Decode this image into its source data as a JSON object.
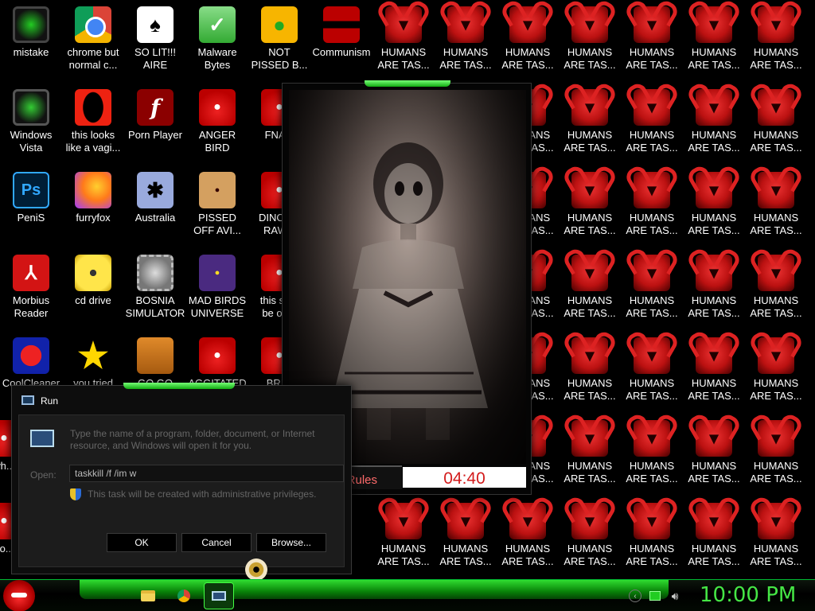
{
  "desktop": {
    "icons": [
      {
        "label": "mistake",
        "icon": "green-sphere-icon"
      },
      {
        "label": "chrome but\nnormal c...",
        "icon": "chrome-icon"
      },
      {
        "label": "SO LIT!!!\nAIRE",
        "icon": "solitaire-card-icon"
      },
      {
        "label": "Malware\nBytes",
        "icon": "shield-check-icon"
      },
      {
        "label": "NOT\nPISSED B...",
        "icon": "green-pig-icon"
      },
      {
        "label": "Communism",
        "icon": "arstotzka-flag-icon"
      },
      {
        "label": "Windows\nVista",
        "icon": "recycle-orb-icon"
      },
      {
        "label": "this looks\nlike a vagi...",
        "icon": "opera-icon"
      },
      {
        "label": "Porn Player",
        "icon": "flash-player-icon"
      },
      {
        "label": "ANGER\nBIRD",
        "icon": "angry-bird-icon"
      },
      {
        "label": "FNA...",
        "icon": "angry-bird-icon"
      },
      {
        "label": "PeniS",
        "icon": "photoshop-icon"
      },
      {
        "label": "furryfox",
        "icon": "firefox-icon"
      },
      {
        "label": "Australia",
        "icon": "spider-solitaire-icon"
      },
      {
        "label": "PISSED\nOFF AVI...",
        "icon": "angry-birds-seasons-icon"
      },
      {
        "label": "DINOS...\nRAW...",
        "icon": "angry-bird-icon"
      },
      {
        "label": "Morbius\nReader",
        "icon": "pdf-reader-icon"
      },
      {
        "label": "cd drive",
        "icon": "cd-drive-icon"
      },
      {
        "label": "BOSNIA\nSIMULATOR",
        "icon": "spiked-mine-icon"
      },
      {
        "label": "MAD BIRDS\nUNIVERSE",
        "icon": "angry-birds-space-icon"
      },
      {
        "label": "this sh...\nbe on...",
        "icon": "angry-bird-icon"
      },
      {
        "label": "CoolCleaner",
        "icon": "ccleaner-icon"
      },
      {
        "label": "you tried",
        "icon": "gold-star-icon"
      },
      {
        "label": "GO GO",
        "icon": "briefcase-icon"
      },
      {
        "label": "AGGITATED",
        "icon": "angry-bird-icon"
      },
      {
        "label": "BRI...",
        "icon": "angry-bird-icon"
      },
      {
        "label": "wh...",
        "icon": "angry-bird-icon"
      },
      {
        "label": "do...",
        "icon": "angry-bird-icon"
      }
    ],
    "demon_label": "HUMANS\nARE TAS...",
    "demon_icon": "red-demon-icon"
  },
  "horror_window": {
    "show_rules": "Show Rules",
    "timer": "04:40",
    "image_subject": "ghost-girl-photo"
  },
  "run_dialog": {
    "title": "Run",
    "description": "Type the name of a program, folder, document, or Internet\nresource, and Windows will open it for you.",
    "open_label": "Open:",
    "input_value": "taskkill /f /im w",
    "admin_note": "This task will be created with administrative privileges.",
    "ok": "OK",
    "cancel": "Cancel",
    "browse": "Browse..."
  },
  "taskbar": {
    "clock": "10:00 PM",
    "start_icon": "angry-bird-start-icon",
    "pinned": [
      "folder-icon",
      "chrome-icon",
      "run-icon"
    ],
    "tray": [
      "show-hidden-icons-icon",
      "network-icon",
      "volume-icon"
    ]
  },
  "colors": {
    "accent_green": "#45e645",
    "timer_red": "#d31c1c",
    "rules_text": "#ff6b6b"
  }
}
